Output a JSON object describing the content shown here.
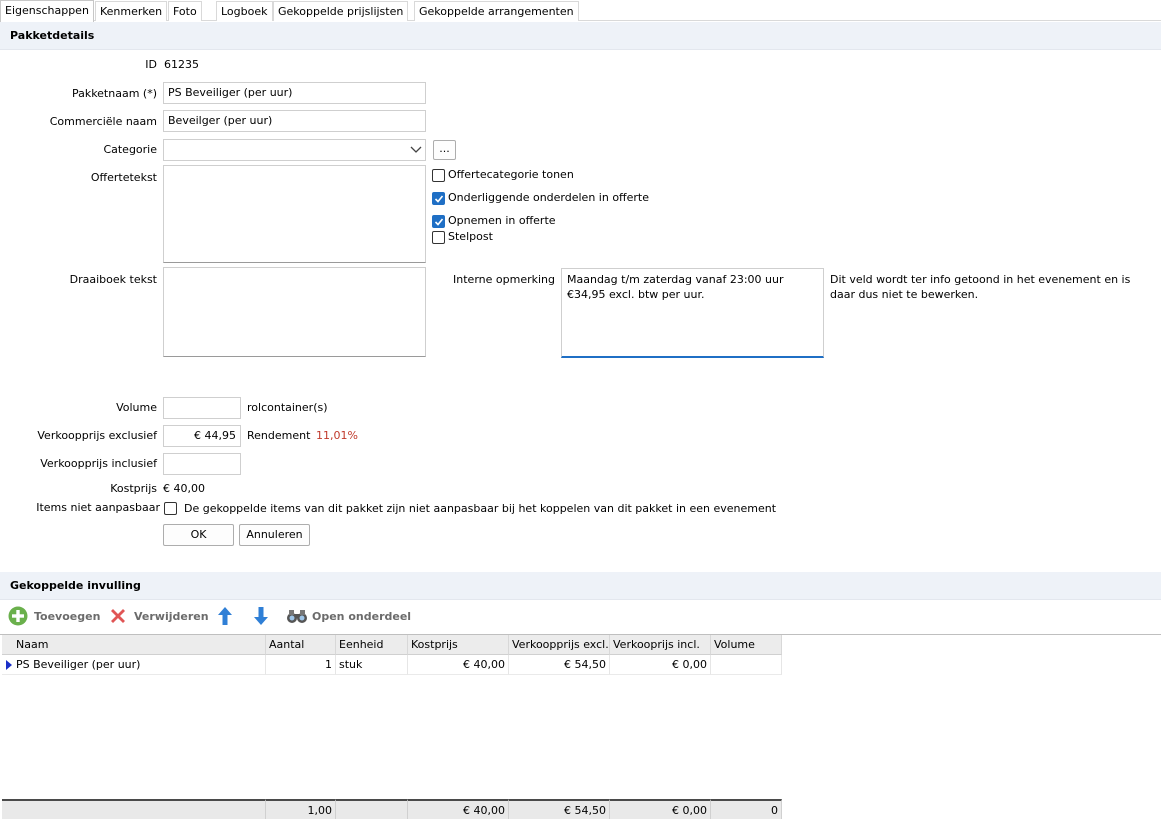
{
  "tabs": [
    "Eigenschappen",
    "Kenmerken",
    "Foto",
    "Logboek",
    "Gekoppelde prijslijsten",
    "Gekoppelde arrangementen"
  ],
  "details": {
    "header": "Pakketdetails",
    "id_label": "ID",
    "id_value": "61235",
    "pakketnaam_label": "Pakketnaam (*)",
    "pakketnaam_value": "PS Beveiliger (per uur)",
    "commercieel_label": "Commerciële naam",
    "commercieel_value": "Beveilger (per uur)",
    "categorie_label": "Categorie",
    "categorie_value": "",
    "browse_label": "...",
    "offertetekst_label": "Offertetekst",
    "draaiboek_label": "Draaiboek tekst",
    "interne_label": "Interne opmerking",
    "interne_value": "Maandag t/m zaterdag vanaf 23:00 uur €34,95 excl. btw per uur.",
    "interne_note": "Dit veld wordt ter info getoond in het evenement en is daar dus niet te bewerken.",
    "options": [
      {
        "label": "Offertecategorie tonen",
        "checked": false
      },
      {
        "label": "Onderliggende onderdelen in offerte",
        "checked": true
      },
      {
        "label": "Opnemen in offerte",
        "checked": true
      },
      {
        "label": "Stelpost",
        "checked": false
      }
    ],
    "volume_label": "Volume",
    "volume_value": "",
    "volume_unit": "rolcontainer(s)",
    "vp_excl_label": "Verkoopprijs exclusief",
    "vp_excl_value": "€ 44,95",
    "rendement_label": "Rendement",
    "rendement_value": "11,01%",
    "vp_incl_label": "Verkoopprijs inclusief",
    "vp_incl_value": "",
    "kostprijs_label": "Kostprijs",
    "kostprijs_value": "€ 40,00",
    "items_label": "Items niet aanpasbaar",
    "items_text": "De gekoppelde items van dit pakket zijn niet aanpasbaar bij het koppelen van dit pakket in een evenement",
    "items_checked": false,
    "ok_label": "OK",
    "cancel_label": "Annuleren"
  },
  "invulling": {
    "header": "Gekoppelde invulling",
    "toolbar": {
      "add": "Toevoegen",
      "remove": "Verwijderen",
      "open": "Open onderdeel"
    },
    "columns": [
      "Naam",
      "Aantal",
      "Eenheid",
      "Kostprijs",
      "Verkoopprijs excl.",
      "Verkooprijs incl.",
      "Volume"
    ],
    "rows": [
      [
        "PS Beveiliger (per uur)",
        "1",
        "stuk",
        "€ 40,00",
        "€ 54,50",
        "€ 0,00",
        ""
      ]
    ],
    "footer": [
      "",
      "1,00",
      "",
      "€ 40,00",
      "€ 54,50",
      "€ 0,00",
      "0"
    ]
  },
  "colors": {
    "accent": "#1f6fc5",
    "section_bg": "#eef2f8",
    "rendement": "#c0392b",
    "add_icon": "#6ab04c",
    "remove_icon": "#e05555",
    "arrow_icon": "#2f7fd6"
  }
}
